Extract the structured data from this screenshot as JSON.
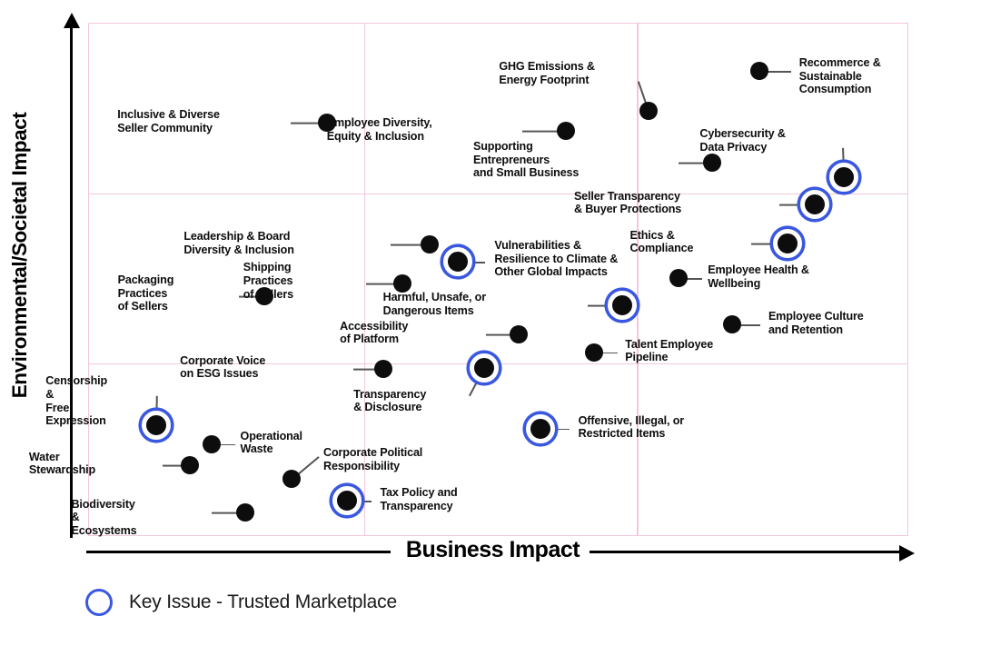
{
  "chart_data": {
    "type": "scatter",
    "title": "",
    "xlabel": "Business Impact",
    "ylabel": "Environmental/Societal Impact",
    "xlim": [
      0,
      100
    ],
    "ylim": [
      0,
      100
    ],
    "grid": true,
    "grid_x": [
      33.5,
      66.8
    ],
    "grid_y": [
      33.8,
      66.9
    ],
    "legend": {
      "position": "below-left",
      "entries": [
        {
          "label": "Key Issue - Trusted Marketplace",
          "marker": "blue-ring"
        }
      ]
    },
    "notes": "Materiality matrix. x = Business Impact, y = Environmental/Societal Impact, both 0-100 normalized to plot box.",
    "points": [
      {
        "label": "Inclusive & Diverse\nSeller Community",
        "x": 29.0,
        "y": 80.7,
        "key_issue": false,
        "label_side": "left"
      },
      {
        "label": "Employee Diversity,\nEquity & Inclusion",
        "x": 58.1,
        "y": 79.1,
        "key_issue": false,
        "label_side": "left"
      },
      {
        "label": "GHG Emissions &\nEnergy Footprint",
        "x": 68.2,
        "y": 83.0,
        "key_issue": false,
        "label_side": "above"
      },
      {
        "label": "Recommerce &\nSustainable Consumption",
        "x": 81.7,
        "y": 90.8,
        "key_issue": false,
        "label_side": "right"
      },
      {
        "label": "Supporting\nEntrepreneurs\nand Small Business",
        "x": 76.0,
        "y": 72.9,
        "key_issue": false,
        "label_side": "left"
      },
      {
        "label": "Cybersecurity &\nData Privacy",
        "x": 92.0,
        "y": 70.1,
        "key_issue": true,
        "label_side": "above"
      },
      {
        "label": "Seller Transparency\n& Buyer Protections",
        "x": 88.5,
        "y": 64.8,
        "key_issue": true,
        "label_side": "left"
      },
      {
        "label": "Leadership & Board\nDiversity & Inclusion",
        "x": 41.5,
        "y": 57.0,
        "key_issue": false,
        "label_side": "left"
      },
      {
        "label": "Vulnerabilities &\nResilience to Climate &\nOther Global Impacts",
        "x": 45.0,
        "y": 53.6,
        "key_issue": true,
        "label_side": "right"
      },
      {
        "label": "Ethics &\nCompliance",
        "x": 85.2,
        "y": 57.2,
        "key_issue": true,
        "label_side": "left"
      },
      {
        "label": "Employee Health &\nWellbeing",
        "x": 71.9,
        "y": 50.4,
        "key_issue": false,
        "label_side": "right"
      },
      {
        "label": "Shipping\nPractices\nof Sellers",
        "x": 38.2,
        "y": 49.3,
        "key_issue": false,
        "label_side": "left"
      },
      {
        "label": "Packaging\nPractices\nof Sellers",
        "x": 21.4,
        "y": 46.9,
        "key_issue": false,
        "label_side": "left"
      },
      {
        "label": "Harmful, Unsafe, or\nDangerous Items",
        "x": 65.0,
        "y": 45.1,
        "key_issue": true,
        "label_side": "left"
      },
      {
        "label": "Employee Culture\nand Retention",
        "x": 78.4,
        "y": 41.4,
        "key_issue": false,
        "label_side": "right"
      },
      {
        "label": "Accessibility\nof Platform",
        "x": 52.4,
        "y": 39.5,
        "key_issue": false,
        "label_side": "left"
      },
      {
        "label": "Talent Employee\nPipeline",
        "x": 61.6,
        "y": 36.0,
        "key_issue": false,
        "label_side": "right"
      },
      {
        "label": "Corporate Voice\non ESG Issues",
        "x": 35.9,
        "y": 32.8,
        "key_issue": false,
        "label_side": "left"
      },
      {
        "label": "Transparency\n& Disclosure",
        "x": 48.2,
        "y": 33.0,
        "key_issue": true,
        "label_side": "below"
      },
      {
        "label": "Offensive, Illegal, or\nRestricted Items",
        "x": 55.0,
        "y": 21.1,
        "key_issue": true,
        "label_side": "right"
      },
      {
        "label": "Censorship &\nFree Expression",
        "x": 8.2,
        "y": 21.7,
        "key_issue": true,
        "label_side": "above"
      },
      {
        "label": "Operational\nWaste",
        "x": 14.9,
        "y": 18.1,
        "key_issue": false,
        "label_side": "right"
      },
      {
        "label": "Water\nStewardship",
        "x": 12.3,
        "y": 14.0,
        "key_issue": false,
        "label_side": "left"
      },
      {
        "label": "Corporate Political\nResponsibility",
        "x": 24.7,
        "y": 11.3,
        "key_issue": false,
        "label_side": "above-right"
      },
      {
        "label": "Tax Policy and\nTransparency",
        "x": 31.5,
        "y": 7.0,
        "key_issue": true,
        "label_side": "right"
      },
      {
        "label": "Biodiversity &\nEcosystems",
        "x": 19.1,
        "y": 4.8,
        "key_issue": false,
        "label_side": "left"
      }
    ]
  },
  "axes": {
    "x_label": "Business Impact",
    "y_label": "Environmental/Societal Impact"
  },
  "legend": {
    "key_issue_label": "Key Issue - Trusted Marketplace"
  },
  "colors": {
    "grid": "#f2c6dd",
    "marker": "#0d0d0d",
    "key_ring": "#3a57e0",
    "axis": "#000000",
    "leader": "#555555"
  }
}
